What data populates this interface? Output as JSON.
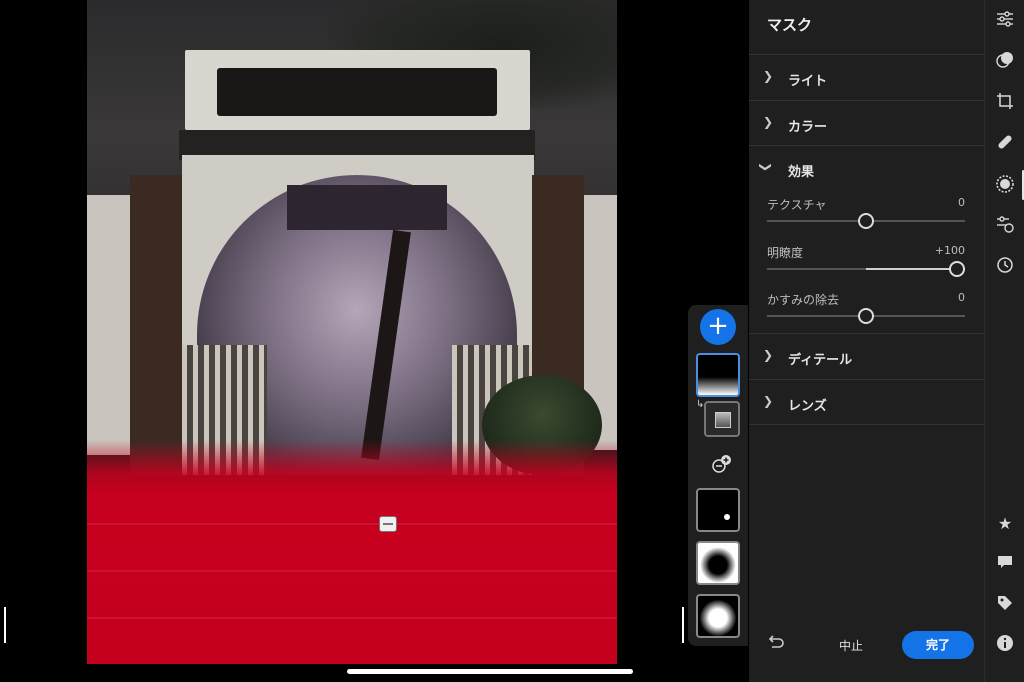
{
  "panel": {
    "title": "マスク",
    "sections": [
      {
        "label": "ライト",
        "expanded": false
      },
      {
        "label": "カラー",
        "expanded": false
      },
      {
        "label": "効果",
        "expanded": true
      },
      {
        "label": "ディテール",
        "expanded": false
      },
      {
        "label": "レンズ",
        "expanded": false
      }
    ],
    "effects": [
      {
        "name": "テクスチャ",
        "value": "0",
        "level": 0.5
      },
      {
        "name": "明瞭度",
        "value": "+100",
        "level": 1.0
      },
      {
        "name": "かすみの除去",
        "value": "0",
        "level": 0.5
      }
    ],
    "cancel_label": "中止",
    "done_label": "完了"
  },
  "mask_strip": {
    "add_label": "+",
    "masks": [
      "linear-gradient-mask",
      "spot-mask",
      "radial-mask-inverted",
      "radial-mask"
    ]
  },
  "rail": {
    "icons": [
      "edit-sliders-icon",
      "presets-icon",
      "crop-icon",
      "healing-icon",
      "masking-icon",
      "versions-icon",
      "history-icon",
      "star-icon",
      "comment-icon",
      "tag-icon",
      "info-icon"
    ]
  },
  "colors": {
    "accent": "#1473e6",
    "mask_overlay": "#c8001f",
    "panel_bg": "#1f1f1f"
  }
}
